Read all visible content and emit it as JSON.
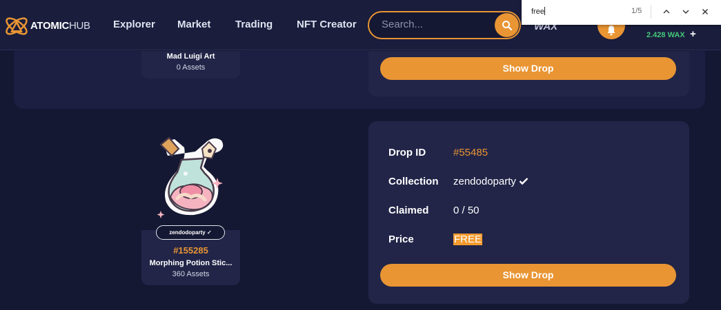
{
  "header": {
    "logo_bold": "ATOMIC",
    "logo_light": "HUB",
    "nav": [
      "Explorer",
      "Market",
      "Trading",
      "NFT Creator"
    ],
    "search_placeholder": "Search...",
    "chain_label": "WAX",
    "balance": "2.428 WAX",
    "balance_add": "+"
  },
  "find_bar": {
    "query": "free",
    "count": "1/5"
  },
  "upper_drop": {
    "collection_name": "Mad Luigi Art",
    "assets": "0 Assets",
    "button": "Show Drop"
  },
  "drop": {
    "card": {
      "collection_pill": "zendodoparty ✓",
      "template_id": "#155285",
      "name": "Morphing Potion Stic...",
      "assets": "360 Assets"
    },
    "details": {
      "drop_id_label": "Drop ID",
      "drop_id_value": "#55485",
      "collection_label": "Collection",
      "collection_value": "zendodoparty",
      "claimed_label": "Claimed",
      "claimed_value": "0 / 50",
      "price_label": "Price",
      "price_value": "FREE"
    },
    "button": "Show Drop"
  },
  "colors": {
    "accent": "#e99533",
    "background": "#151833",
    "panel": "#222548",
    "balance_green": "#43c77a"
  }
}
